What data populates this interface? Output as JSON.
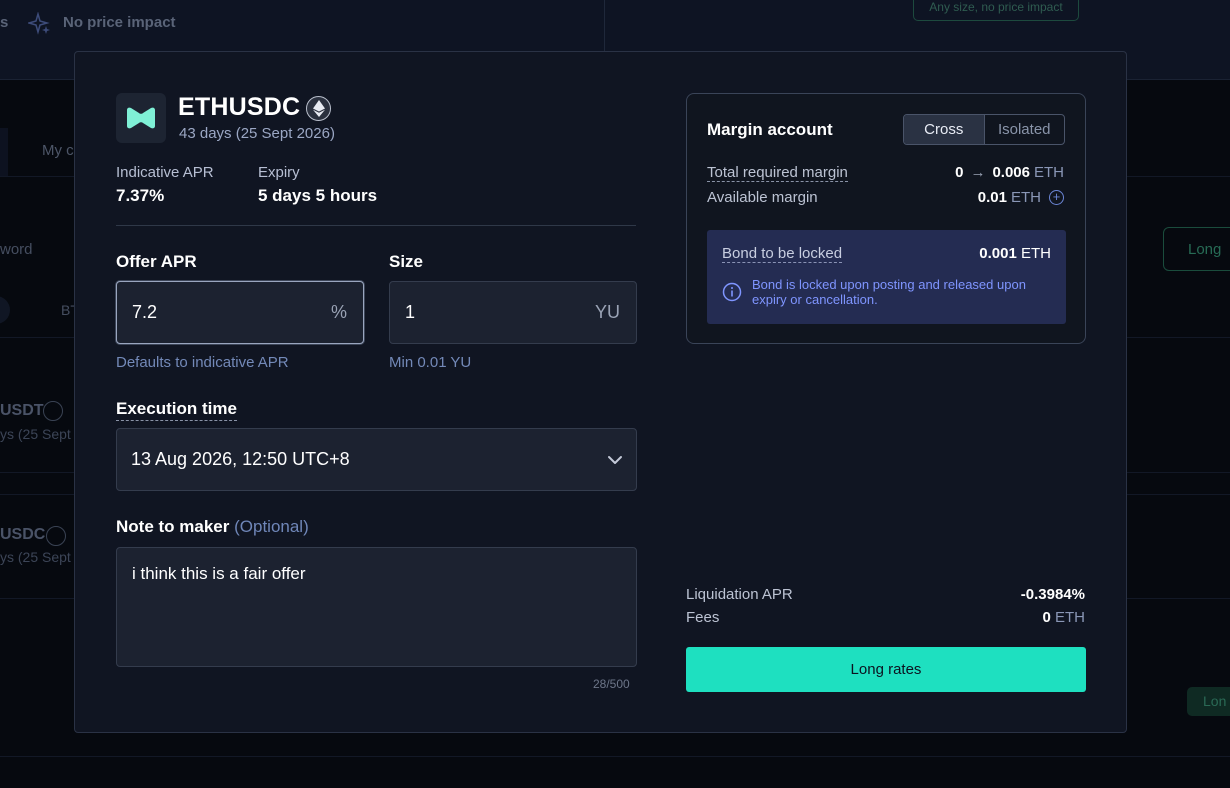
{
  "background": {
    "top_fragment": "s",
    "no_price_impact": "No price impact",
    "pill": "Any size, no price impact",
    "tab_fragment": "My c",
    "word_fragment": "word",
    "bt_fragment": "BT",
    "long_button": "Long",
    "rows": [
      {
        "title": "USDT",
        "sub": "ys (25 Sept"
      },
      {
        "title": "USDC",
        "sub": "ys (25 Sept"
      }
    ],
    "long_button_small": "Lon"
  },
  "modal": {
    "token": {
      "name": "ETHUSDC",
      "subtitle": "43 days (25 Sept 2026)",
      "icon": "eth-icon"
    },
    "stats": {
      "apr_label": "Indicative APR",
      "apr_value": "7.37%",
      "expiry_label": "Expiry",
      "expiry_value": "5 days 5 hours"
    },
    "offer_apr": {
      "label": "Offer APR",
      "value": "7.2",
      "unit": "%",
      "hint": "Defaults to indicative APR"
    },
    "size": {
      "label": "Size",
      "value": "1",
      "unit": "YU",
      "hint": "Min 0.01 YU"
    },
    "execution_time": {
      "label": "Execution time",
      "value": "13 Aug 2026, 12:50 UTC+8"
    },
    "note": {
      "label": "Note to maker",
      "optional": "(Optional)",
      "value": "i think this is a fair offer",
      "counter": "28/500"
    },
    "margin": {
      "title": "Margin account",
      "modes": [
        "Cross",
        "Isolated"
      ],
      "active_mode": "Cross",
      "total_label": "Total required margin",
      "total_from": "0",
      "total_to": "0.006",
      "total_unit": "ETH",
      "available_label": "Available margin",
      "available_value": "0.01",
      "available_unit": "ETH",
      "bond_label": "Bond to be locked",
      "bond_value": "0.001",
      "bond_unit": "ETH",
      "bond_note": "Bond is locked upon posting and released upon expiry or cancellation."
    },
    "liquidation": {
      "label": "Liquidation APR",
      "value": "-0.3984%"
    },
    "fees": {
      "label": "Fees",
      "value": "0",
      "unit": "ETH"
    },
    "cta": "Long rates"
  },
  "colors": {
    "accent": "#1ee0c0",
    "bond_bg": "#242c52",
    "bond_text": "#7f95ff",
    "modal_bg": "#101522"
  }
}
